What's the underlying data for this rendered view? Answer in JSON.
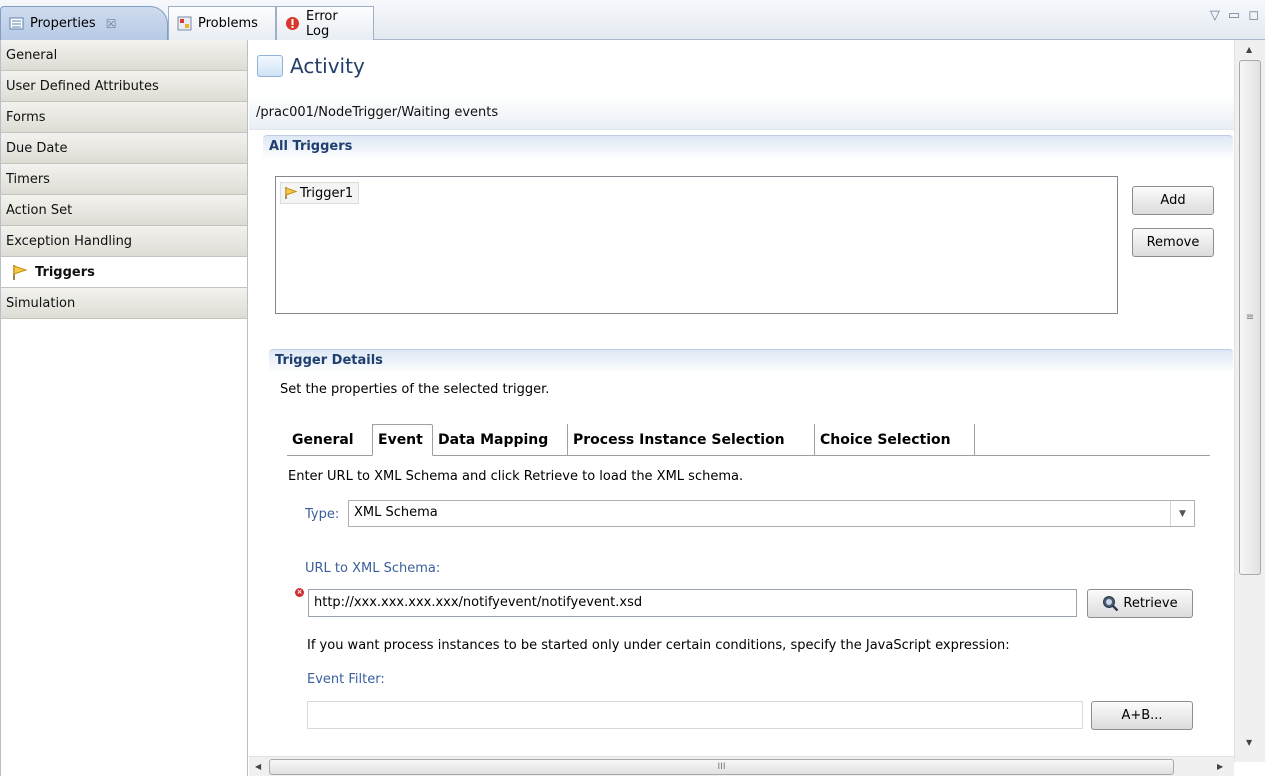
{
  "tabs": [
    {
      "label": "Properties",
      "icon": "properties-icon",
      "active": true,
      "close": "☒"
    },
    {
      "label": "Problems",
      "icon": "problems-icon",
      "active": false
    },
    {
      "label": "Error Log",
      "icon": "error-log-icon",
      "active": false
    }
  ],
  "tabbar_controls": {
    "menu": "▽",
    "minimize": "▭",
    "maximize": "◻"
  },
  "sidebar": {
    "items": [
      {
        "label": "General"
      },
      {
        "label": "User Defined Attributes"
      },
      {
        "label": "Forms"
      },
      {
        "label": "Due Date"
      },
      {
        "label": "Timers"
      },
      {
        "label": "Action Set"
      },
      {
        "label": "Exception Handling"
      },
      {
        "label": "Triggers",
        "active": true,
        "icon": "trigger-flag-icon"
      },
      {
        "label": "Simulation"
      }
    ]
  },
  "header": {
    "title": "Activity",
    "path": "/prac001/NodeTrigger/Waiting events"
  },
  "all_triggers": {
    "heading": "All Triggers",
    "items": [
      {
        "label": "Trigger1",
        "icon": "trigger-flag-icon"
      }
    ],
    "add_label": "Add",
    "remove_label": "Remove"
  },
  "trigger_details": {
    "heading": "Trigger Details",
    "description": "Set the properties of the selected trigger.",
    "tabs": [
      {
        "label": "General"
      },
      {
        "label": "Event",
        "active": true
      },
      {
        "label": "Data Mapping"
      },
      {
        "label": "Process Instance Selection"
      },
      {
        "label": "Choice Selection"
      }
    ],
    "event": {
      "instruction": "Enter URL to XML Schema and click Retrieve to load the XML schema.",
      "type_label": "Type:",
      "type_value": "XML Schema",
      "url_label": "URL to XML Schema:",
      "url_value": "http://xxx.xxx.xxx.xxx/notifyevent/notifyevent.xsd",
      "retrieve_label": "Retrieve",
      "hint": "If you want process instances to be started only under certain conditions, specify the JavaScript expression:",
      "filter_label": "Event Filter:",
      "filter_value": "",
      "expression_button_label": "A+B..."
    }
  },
  "colors": {
    "link_blue": "#3a5f9c",
    "title_blue": "#243e6a",
    "error_red": "#d12f2f"
  }
}
